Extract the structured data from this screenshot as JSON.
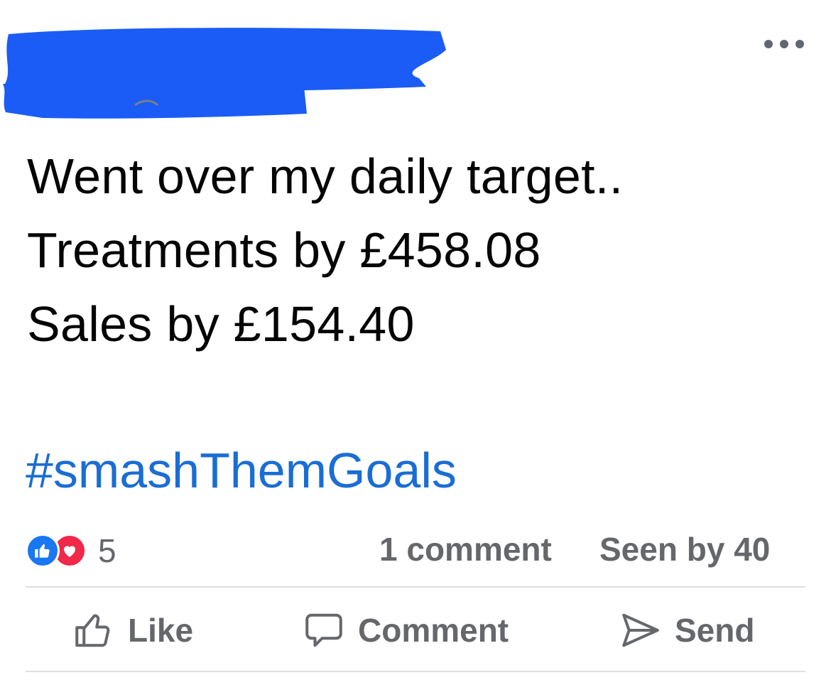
{
  "post": {
    "body_lines": [
      "Went over my daily target..",
      "Treatments by £458.08",
      "Sales by £154.40"
    ],
    "hashtag": "#smashThemGoals"
  },
  "stats": {
    "reaction_count": "5",
    "comments": "1 comment",
    "seen_by": "Seen by 40"
  },
  "actions": {
    "like": "Like",
    "comment": "Comment",
    "send": "Send"
  },
  "icons": {
    "more": "more-horizontal-icon",
    "reaction_like": "thumbs-up-icon",
    "reaction_love": "heart-icon",
    "like": "thumbs-up-outline-icon",
    "comment": "speech-bubble-icon",
    "send": "paper-plane-icon"
  },
  "colors": {
    "redaction": "#1a5cf5",
    "hashtag": "#1a6dd4",
    "muted_text": "#65676b",
    "like_blue": "#1877f2",
    "love_red": "#f02849",
    "divider": "#dddfe2"
  }
}
